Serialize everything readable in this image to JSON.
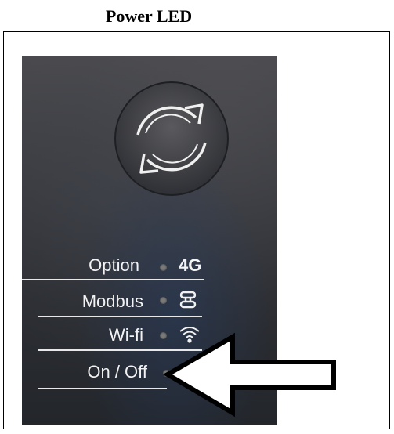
{
  "heading": "Power LED",
  "panel": {
    "rows": [
      {
        "label": "Option",
        "indicator": "4G",
        "icon": "text-4g"
      },
      {
        "label": "Modbus",
        "icon": "modbus-icon"
      },
      {
        "label": "Wi-fi",
        "icon": "wifi-icon"
      },
      {
        "label": "On / Off",
        "icon": "arrow-pointer"
      }
    ]
  }
}
